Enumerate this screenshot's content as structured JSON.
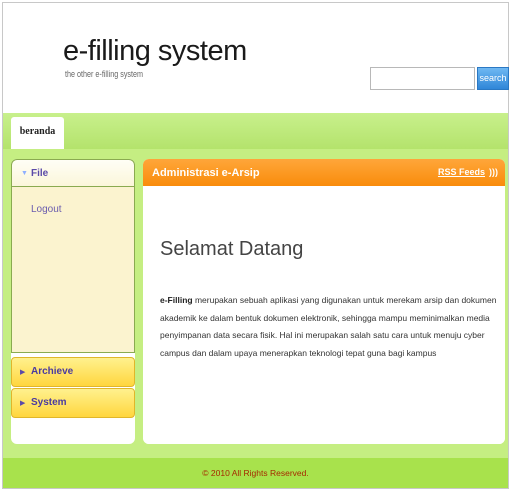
{
  "header": {
    "logo_title": "e-filling system",
    "logo_subtitle": "the other e-filling system",
    "search_placeholder": "",
    "search_button": "search"
  },
  "nav": {
    "tabs": [
      {
        "label": "beranda"
      }
    ]
  },
  "sidebar": {
    "file_label": "File",
    "file_items": [
      {
        "label": "Logout"
      }
    ],
    "sections": [
      {
        "label": "Archieve"
      },
      {
        "label": "System"
      }
    ]
  },
  "content": {
    "title": "Administrasi e-Arsip",
    "rss_label": "RSS Feeds",
    "welcome": "Selamat Datang",
    "paragraph_bold": "e-Filling",
    "paragraph_rest": " merupakan sebuah aplikasi yang digunakan untuk merekam arsip dan dokumen akademik ke dalam bentuk dokumen elektronik, sehingga mampu meminimalkan media penyimpanan data secara fisik. Hal ini merupakan salah satu cara untuk menuju cyber campus dan dalam upaya menerapkan teknologi tepat guna bagi kampus"
  },
  "footer": {
    "text": "© 2010 All Rights Reserved."
  },
  "colors": {
    "nav_green": "#b4e36c",
    "main_green": "#c5ee82",
    "footer_green": "#a8e24c",
    "content_header_orange": "#f98c0b",
    "sidebar_section_yellow": "#ffd63e",
    "search_blue": "#2f86d8"
  },
  "icons": {
    "file_arrow": "triangle-down-icon",
    "section_arrow": "triangle-right-icon",
    "rss": "rss-icon"
  }
}
